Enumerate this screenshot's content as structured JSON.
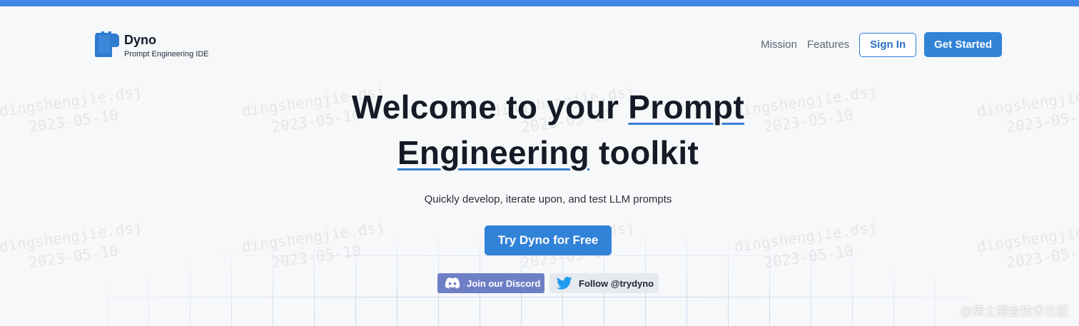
{
  "brand": {
    "name": "Dyno",
    "tagline": "Prompt Engineering IDE"
  },
  "nav": {
    "links": [
      "Mission",
      "Features"
    ],
    "sign_in": "Sign In",
    "get_started": "Get Started"
  },
  "hero": {
    "title_part1": "Welcome to your ",
    "title_highlight1": "Prompt",
    "title_highlight2": "Engineering",
    "title_part2": " toolkit",
    "subtitle": "Quickly develop, iterate upon, and test LLM prompts",
    "cta": "Try Dyno for Free"
  },
  "social": {
    "discord": "Join our Discord",
    "twitter": "Follow @trydyno"
  },
  "watermark": {
    "user": "dingshengjie.dsj",
    "date": "2023-05-10"
  },
  "corner_watermark": "@稀土掘金技术社区",
  "colors": {
    "accent": "#3183d8",
    "top_bar": "#3f86e6",
    "discord": "#6f7fc6"
  }
}
